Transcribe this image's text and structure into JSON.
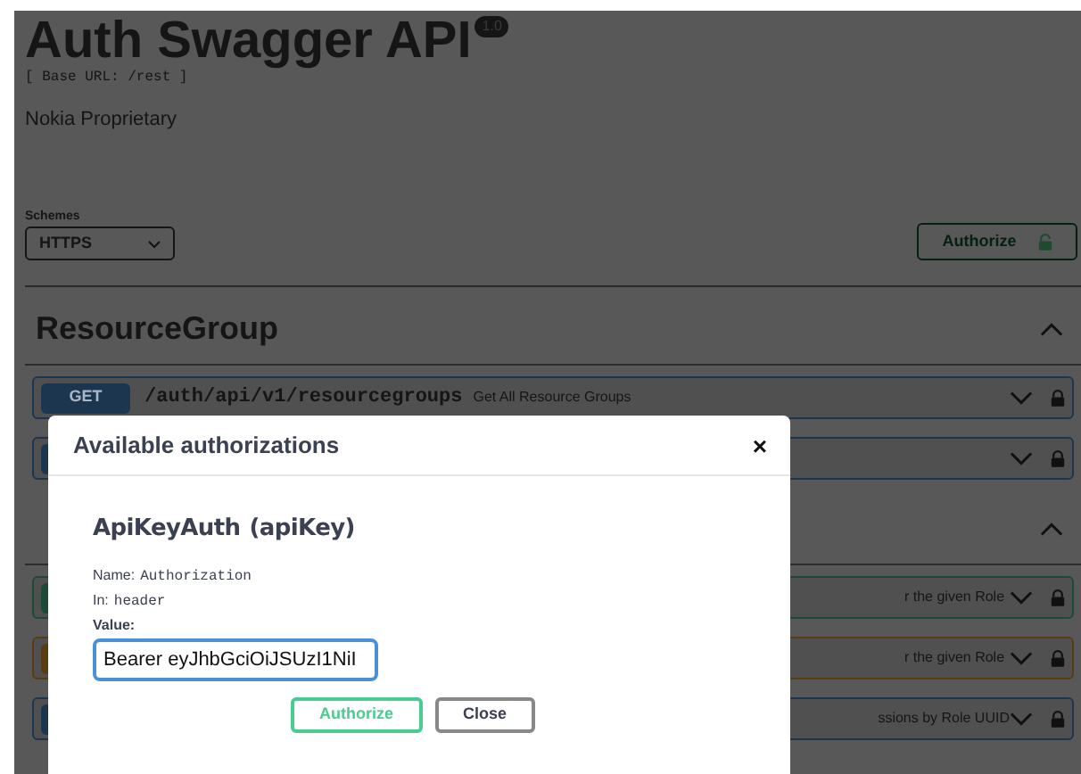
{
  "header": {
    "title": "Auth Swagger API",
    "version": "1.0",
    "base_url": "[ Base URL: /rest ]",
    "description": "Nokia Proprietary"
  },
  "schemes": {
    "label": "Schemes",
    "value": "HTTPS"
  },
  "authorize_button": {
    "label": "Authorize"
  },
  "sections": [
    {
      "title": "ResourceGroup",
      "expanded": true,
      "operations": [
        {
          "method": "GET",
          "color": "#1d3650",
          "path": "/auth/api/v1/resourcegroups",
          "summary": "Get All Resource Groups"
        },
        {
          "color": "#1d3650"
        }
      ]
    },
    {
      "expanded": true,
      "operations": [
        {
          "color": "#1d4a34",
          "summary": "r the given Role"
        },
        {
          "color": "#5a3c12",
          "summary": "r the given Role"
        },
        {
          "color": "#1d3650",
          "summary": "ssions by Role UUID"
        }
      ]
    }
  ],
  "modal": {
    "title": "Available authorizations",
    "close": "×",
    "scheme_name": "ApiKeyAuth",
    "scheme_type": "(apiKey)",
    "name_label": "Name:",
    "name_value": "Authorization",
    "in_label": "In:",
    "in_value": "header",
    "value_label": "Value:",
    "value": "Bearer eyJhbGciOiJSUzI1NiI",
    "buttons": [
      {
        "label": "Authorize",
        "kind": "primary"
      },
      {
        "label": "Close",
        "kind": "secondary"
      }
    ]
  }
}
